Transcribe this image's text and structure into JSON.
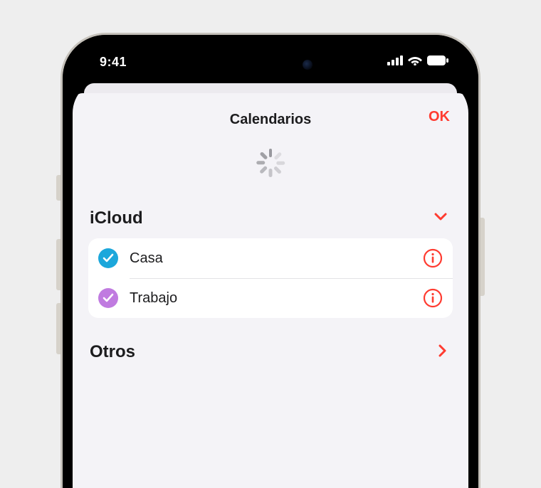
{
  "status": {
    "time": "9:41"
  },
  "sheet": {
    "title": "Calendarios",
    "ok_label": "OK"
  },
  "sections": {
    "icloud": {
      "title": "iCloud",
      "items": [
        {
          "label": "Casa",
          "color": "blue"
        },
        {
          "label": "Trabajo",
          "color": "purple"
        }
      ]
    },
    "other": {
      "title": "Otros"
    }
  },
  "colors": {
    "accent": "#ff3b30"
  },
  "icons": {
    "info": "info-circle",
    "chevron_down": "chevron-down",
    "chevron_right": "chevron-right",
    "check": "checkmark",
    "signal": "cellular-signal",
    "wifi": "wifi",
    "battery": "battery-full"
  }
}
